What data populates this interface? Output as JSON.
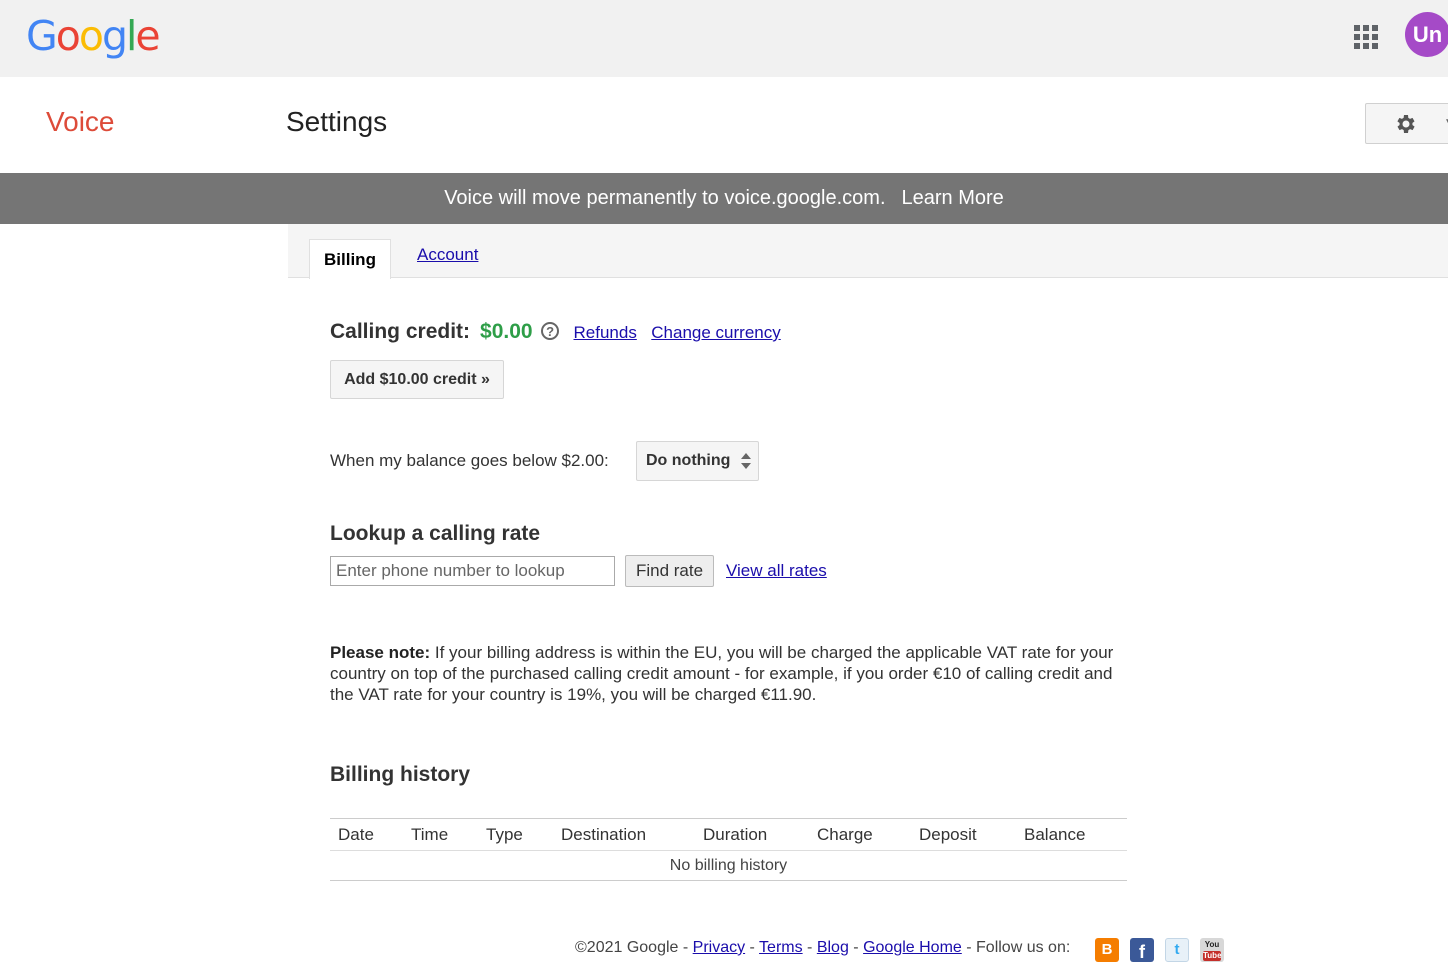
{
  "topbar": {
    "logo_letters": [
      {
        "char": "G",
        "color": "#4285f4"
      },
      {
        "char": "o",
        "color": "#ea4335"
      },
      {
        "char": "o",
        "color": "#fbbc05"
      },
      {
        "char": "g",
        "color": "#4285f4"
      },
      {
        "char": "l",
        "color": "#34a853"
      },
      {
        "char": "e",
        "color": "#ea4335"
      }
    ],
    "apps_icon": "apps-grid-icon",
    "avatar_text": "Un",
    "avatar_color": "#a54ac7"
  },
  "header": {
    "app_name": "Voice",
    "page_title": "Settings",
    "settings_icon": "gear-icon"
  },
  "banner": {
    "message": "Voice will move permanently to voice.google.com.",
    "link": "Learn More"
  },
  "tabs": [
    {
      "label": "Billing",
      "active": true
    },
    {
      "label": "Account",
      "active": false
    }
  ],
  "billing": {
    "credit_label": "Calling credit:",
    "credit_value": "$0.00",
    "help_icon": "?",
    "refunds_link": "Refunds",
    "change_currency_link": "Change currency",
    "add_credit_button": "Add $10.00 credit »",
    "balance_label": "When my balance goes below $2.00:",
    "balance_action": "Do nothing",
    "lookup_title": "Lookup a calling rate",
    "lookup_placeholder": "Enter phone number to lookup",
    "find_rate_button": "Find rate",
    "view_all_rates_link": "View all rates",
    "note_bold": "Please note:",
    "note_text": " If your billing address is within the EU, you will be charged the applicable VAT rate for your country on top of the purchased calling credit amount - for example, if you order €10 of calling credit and the VAT rate for your country is 19%, you will be charged €11.90.",
    "history_title": "Billing history",
    "history_columns": [
      "Date",
      "Time",
      "Type",
      "Destination",
      "Duration",
      "Charge",
      "Deposit",
      "Balance"
    ],
    "history_empty": "No billing history"
  },
  "footer": {
    "copyright": "©2021 Google -",
    "links": [
      "Privacy",
      "Terms",
      "Blog",
      "Google Home"
    ],
    "follow": "- Follow us on:",
    "social_icons": [
      "blogger-icon",
      "facebook-icon",
      "twitter-icon",
      "youtube-icon"
    ]
  }
}
